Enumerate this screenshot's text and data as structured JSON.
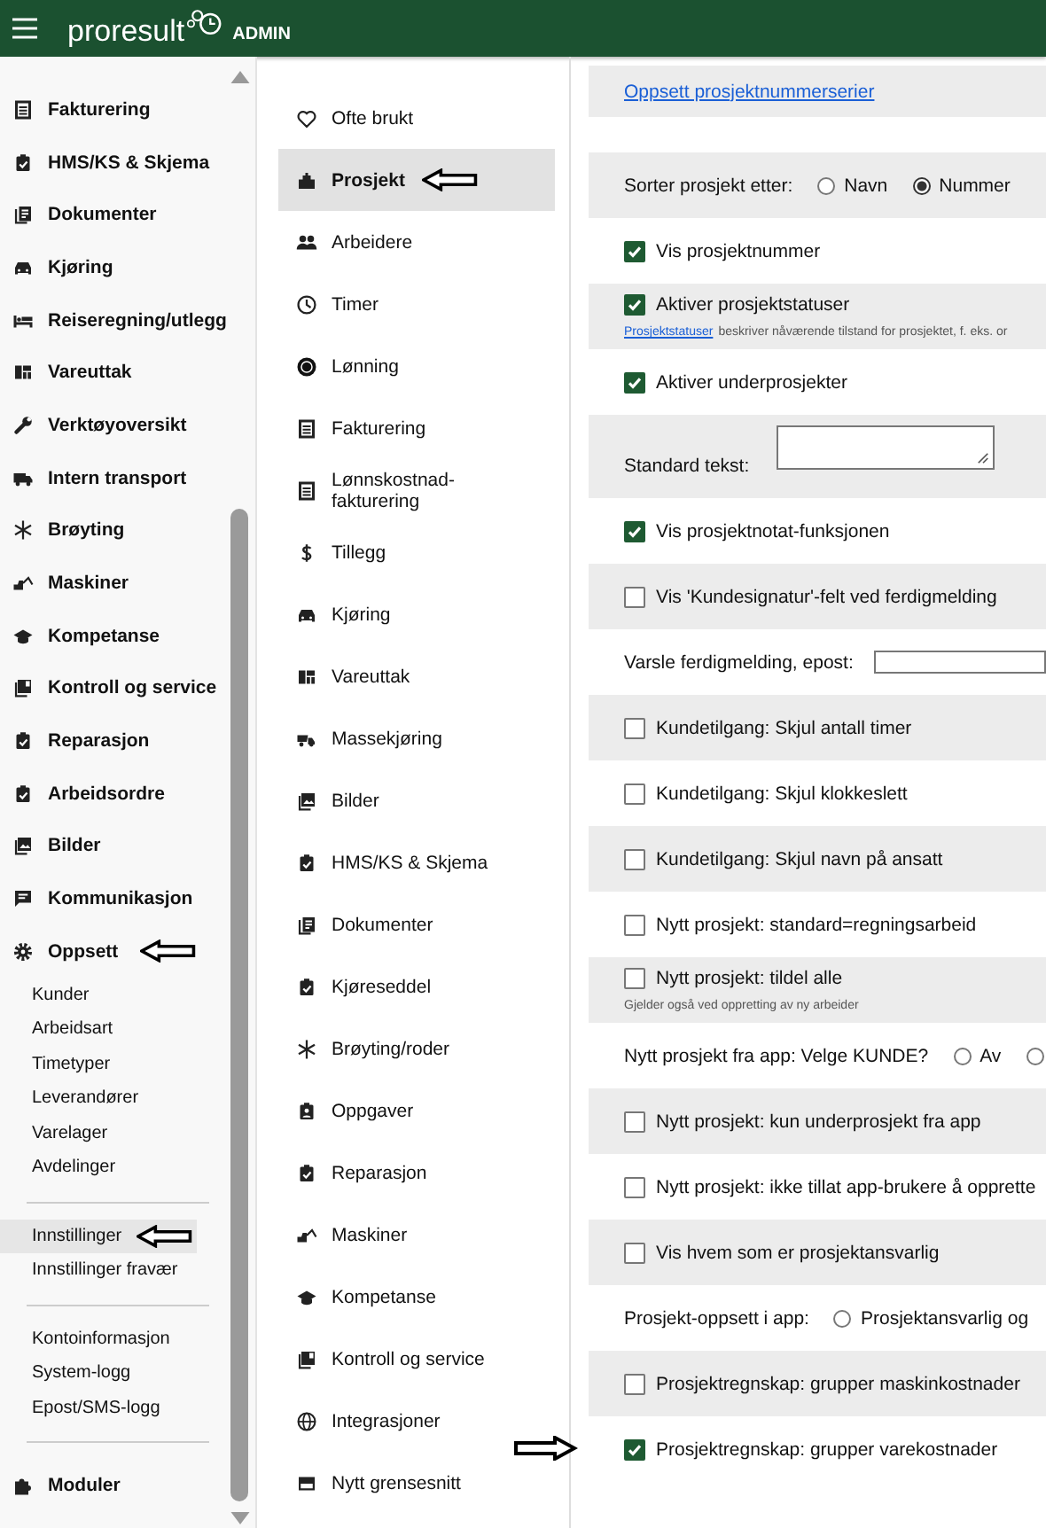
{
  "header": {
    "logo": "proresult",
    "badge": "ADMIN"
  },
  "sidebar": {
    "items": [
      {
        "label": "Fakturering",
        "arrow": false
      },
      {
        "label": "HMS/KS & Skjema",
        "arrow": false
      },
      {
        "label": "Dokumenter",
        "arrow": false
      },
      {
        "label": "Kjøring",
        "arrow": false
      },
      {
        "label": "Reiseregning/utlegg",
        "arrow": false
      },
      {
        "label": "Vareuttak",
        "arrow": false
      },
      {
        "label": "Verktøyoversikt",
        "arrow": false
      },
      {
        "label": "Intern transport",
        "arrow": false
      },
      {
        "label": "Brøyting",
        "arrow": false
      },
      {
        "label": "Maskiner",
        "arrow": false
      },
      {
        "label": "Kompetanse",
        "arrow": false
      },
      {
        "label": "Kontroll og service",
        "arrow": false
      },
      {
        "label": "Reparasjon",
        "arrow": false
      },
      {
        "label": "Arbeidsordre",
        "arrow": false
      },
      {
        "label": "Bilder",
        "arrow": false
      },
      {
        "label": "Kommunikasjon",
        "arrow": false
      },
      {
        "label": "Oppsett",
        "arrow": true
      }
    ],
    "submenu_groups": [
      [
        {
          "label": "Kunder",
          "selected": false,
          "arrow": false
        },
        {
          "label": "Arbeidsart",
          "selected": false,
          "arrow": false
        },
        {
          "label": "Timetyper",
          "selected": false,
          "arrow": false
        },
        {
          "label": "Leverandører",
          "selected": false,
          "arrow": false
        },
        {
          "label": "Varelager",
          "selected": false,
          "arrow": false
        },
        {
          "label": "Avdelinger",
          "selected": false,
          "arrow": false
        }
      ],
      [
        {
          "label": "Innstillinger",
          "selected": true,
          "arrow": true
        },
        {
          "label": "Innstillinger fravær",
          "selected": false,
          "arrow": false
        }
      ],
      [
        {
          "label": "Kontoinformasjon",
          "selected": false,
          "arrow": false
        },
        {
          "label": "System-logg",
          "selected": false,
          "arrow": false
        },
        {
          "label": "Epost/SMS-logg",
          "selected": false,
          "arrow": false
        }
      ]
    ],
    "footer_item": {
      "label": "Moduler"
    }
  },
  "settings_menu": {
    "items": [
      {
        "label": "Ofte brukt",
        "selected": false,
        "arrow": false
      },
      {
        "label": "Prosjekt",
        "selected": true,
        "arrow": true
      },
      {
        "label": "Arbeidere",
        "selected": false,
        "arrow": false
      },
      {
        "label": "Timer",
        "selected": false,
        "arrow": false
      },
      {
        "label": "Lønning",
        "selected": false,
        "arrow": false
      },
      {
        "label": "Fakturering",
        "selected": false,
        "arrow": false
      },
      {
        "label": "Lønnskostnad-fakturering",
        "selected": false,
        "arrow": false
      },
      {
        "label": "Tillegg",
        "selected": false,
        "arrow": false
      },
      {
        "label": "Kjøring",
        "selected": false,
        "arrow": false
      },
      {
        "label": "Vareuttak",
        "selected": false,
        "arrow": false
      },
      {
        "label": "Massekjøring",
        "selected": false,
        "arrow": false
      },
      {
        "label": "Bilder",
        "selected": false,
        "arrow": false
      },
      {
        "label": "HMS/KS & Skjema",
        "selected": false,
        "arrow": false
      },
      {
        "label": "Dokumenter",
        "selected": false,
        "arrow": false
      },
      {
        "label": "Kjøreseddel",
        "selected": false,
        "arrow": false
      },
      {
        "label": "Brøyting/roder",
        "selected": false,
        "arrow": false
      },
      {
        "label": "Oppgaver",
        "selected": false,
        "arrow": false
      },
      {
        "label": "Reparasjon",
        "selected": false,
        "arrow": false
      },
      {
        "label": "Maskiner",
        "selected": false,
        "arrow": false
      },
      {
        "label": "Kompetanse",
        "selected": false,
        "arrow": false
      },
      {
        "label": "Kontroll og service",
        "selected": false,
        "arrow": false
      },
      {
        "label": "Integrasjoner",
        "selected": false,
        "arrow": false
      },
      {
        "label": "Nytt grensesnitt",
        "selected": false,
        "arrow": false
      }
    ]
  },
  "content": {
    "top_link": "Oppsett prosjektnummerserier",
    "rows": [
      {
        "kind": "radio",
        "label": "Sorter prosjekt etter:",
        "options": [
          {
            "label": "Navn",
            "selected": false
          },
          {
            "label": "Nummer",
            "selected": true
          }
        ],
        "arrow": false
      },
      {
        "kind": "checkbox",
        "label": "Vis prosjektnummer",
        "checked": true,
        "arrow": false
      },
      {
        "kind": "checkbox",
        "label": "Aktiver prosjektstatuser",
        "checked": true,
        "note": {
          "link": "Prosjektstatuser",
          "text": "beskriver nåværende tilstand for prosjektet, f. eks. or"
        },
        "arrow": false
      },
      {
        "kind": "checkbox",
        "label": "Aktiver underprosjekter",
        "checked": true,
        "arrow": false
      },
      {
        "kind": "textarea",
        "label": "Standard tekst:",
        "arrow": false
      },
      {
        "kind": "checkbox",
        "label": "Vis prosjektnotat-funksjonen",
        "checked": true,
        "arrow": false
      },
      {
        "kind": "checkbox",
        "label": "Vis 'Kundesignatur'-felt ved ferdigmelding",
        "checked": false,
        "arrow": false
      },
      {
        "kind": "input",
        "label": "Varsle ferdigmelding, epost:",
        "arrow": false
      },
      {
        "kind": "checkbox",
        "label": "Kundetilgang: Skjul antall timer",
        "checked": false,
        "arrow": false
      },
      {
        "kind": "checkbox",
        "label": "Kundetilgang: Skjul klokkeslett",
        "checked": false,
        "arrow": false
      },
      {
        "kind": "checkbox",
        "label": "Kundetilgang: Skjul navn på ansatt",
        "checked": false,
        "arrow": false
      },
      {
        "kind": "checkbox",
        "label": "Nytt prosjekt: standard=regningsarbeid",
        "checked": false,
        "arrow": false
      },
      {
        "kind": "checkbox",
        "label": "Nytt prosjekt: tildel alle",
        "checked": false,
        "note": {
          "text": "Gjelder også ved oppretting av ny arbeider"
        },
        "arrow": false
      },
      {
        "kind": "radio",
        "label": "Nytt prosjekt fra app: Velge KUNDE?",
        "options": [
          {
            "label": "Av",
            "selected": false
          },
          {
            "selected": false
          }
        ],
        "arrow": false
      },
      {
        "kind": "checkbox",
        "label": "Nytt prosjekt: kun underprosjekt fra app",
        "checked": false,
        "arrow": false
      },
      {
        "kind": "checkbox",
        "label": "Nytt prosjekt: ikke tillat app-brukere å opprette",
        "checked": false,
        "arrow": false
      },
      {
        "kind": "checkbox",
        "label": "Vis hvem som er prosjektansvarlig",
        "checked": false,
        "arrow": false
      },
      {
        "kind": "radio",
        "label": "Prosjekt-oppsett i app:",
        "options": [
          {
            "label": "Prosjektansvarlig og",
            "selected": false
          }
        ],
        "arrow": false
      },
      {
        "kind": "checkbox",
        "label": "Prosjektregnskap: grupper maskinkostnader",
        "checked": false,
        "arrow": false
      },
      {
        "kind": "checkbox",
        "label": "Prosjektregnskap: grupper varekostnader",
        "checked": true,
        "arrow": true
      }
    ]
  }
}
